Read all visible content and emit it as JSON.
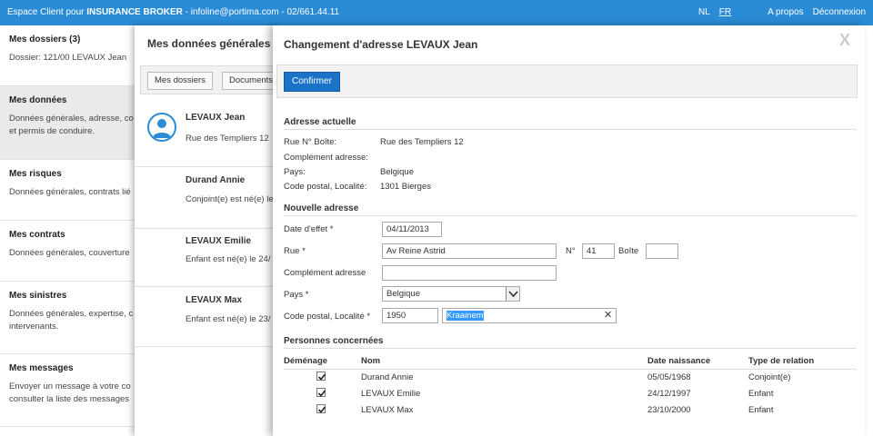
{
  "topbar": {
    "prefix": "Espace Client pour ",
    "brand": "INSURANCE BROKER",
    "contact": " - infoline@portima.com - 02/661.44.11",
    "lang_nl": "NL",
    "lang_fr": "FR",
    "about": "A propos",
    "logout": "Déconnexion"
  },
  "sidebar": {
    "sections": [
      {
        "title": "Mes dossiers (3)",
        "lines": [
          "Dossier: 121/00 LEVAUX Jean"
        ]
      },
      {
        "title": "Mes données",
        "lines": [
          "Données générales, adresse, co",
          "et permis de conduire."
        ]
      },
      {
        "title": "Mes risques",
        "lines": [
          "Données générales, contrats lié"
        ]
      },
      {
        "title": "Mes contrats",
        "lines": [
          "Données générales, couverture"
        ]
      },
      {
        "title": "Mes sinistres",
        "lines": [
          "Données générales, expertise, c",
          "intervenants."
        ]
      },
      {
        "title": "Mes messages",
        "lines": [
          "Envoyer un message à votre co",
          "consulter la liste des messages"
        ]
      }
    ]
  },
  "middle": {
    "title": "Mes données générales",
    "btn_dossiers": "Mes dossiers",
    "btn_documents": "Documents",
    "persons": [
      {
        "name": "LEVAUX Jean",
        "info": "Rue des Templiers 12"
      },
      {
        "name": "Durand Annie",
        "info": "Conjoint(e) est né(e) le"
      },
      {
        "name": "LEVAUX Emilie",
        "info": "Enfant est né(e) le 24/"
      },
      {
        "name": "LEVAUX Max",
        "info": "Enfant est né(e) le 23/"
      }
    ]
  },
  "modal": {
    "title": "Changement d'adresse LEVAUX Jean",
    "close": "X",
    "confirm": "Confirmer",
    "current": {
      "title": "Adresse actuelle",
      "street_label": "Rue N° Boîte:",
      "street_value": "Rue des Templiers 12",
      "complement_label": "Complément adresse:",
      "country_label": "Pays:",
      "country_value": "Belgique",
      "postal_label": "Code postal, Localité:",
      "postal_value": "1301 Bierges"
    },
    "new": {
      "title": "Nouvelle adresse",
      "date_label": "Date d'effet *",
      "date_value": "04/11/2013",
      "street_label": "Rue *",
      "street_value": "Av Reine Astrid",
      "number_label": "N°",
      "number_value": "41",
      "box_label": "Boîte",
      "box_value": "",
      "complement_label": "Complément adresse",
      "complement_value": "",
      "country_label": "Pays *",
      "country_value": "Belgique",
      "postal_label": "Code postal, Localité *",
      "postal_value": "1950",
      "city_value": "Kraainem"
    },
    "persons": {
      "title": "Personnes concernées",
      "headers": {
        "move": "Déménage",
        "name": "Nom",
        "birth": "Date naissance",
        "relation": "Type de relation"
      },
      "rows": [
        {
          "name": "Durand Annie",
          "birth": "05/05/1968",
          "relation": "Conjoint(e)",
          "checked": true
        },
        {
          "name": "LEVAUX Emilie",
          "birth": "24/12/1997",
          "relation": "Enfant",
          "checked": true
        },
        {
          "name": "LEVAUX Max",
          "birth": "23/10/2000",
          "relation": "Enfant",
          "checked": true
        }
      ]
    }
  }
}
